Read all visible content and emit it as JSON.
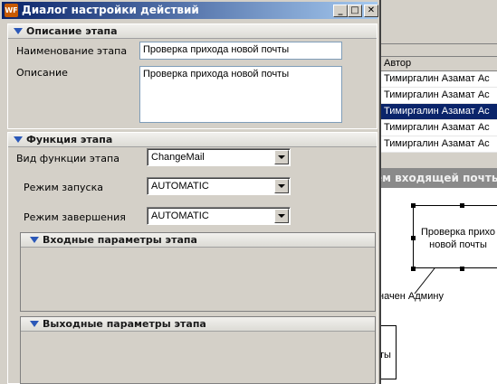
{
  "dialog": {
    "title": "Диалог настройки действий",
    "app_icon_text": "WF",
    "minimize_glyph": "_",
    "maximize_glyph": "□",
    "close_glyph": "✕"
  },
  "stage_description": {
    "header": "Описание этапа",
    "name_label": "Наименование этапа",
    "name_value": "Проверка прихода новой почты",
    "description_label": "Описание",
    "description_value": "Проверка прихода новой почты"
  },
  "stage_function": {
    "header": "Функция этапа",
    "function_type_label": "Вид функции этапа",
    "function_type_value": "ChangeMail",
    "start_mode_label": "Режим запуска",
    "start_mode_value": "AUTOMATIC",
    "finish_mode_label": "Режим завершения",
    "finish_mode_value": "AUTOMATIC",
    "input_params_header": "Входные параметры этапа",
    "output_params_header": "Выходные параметры этапа"
  },
  "background": {
    "author_column": "Автор",
    "rows": [
      "Тимиргалин Азамат Ас",
      "Тимиргалин Азамат Ас",
      "Тимиргалин Азамат Ас",
      "Тимиргалин Азамат Ас",
      "Тимиргалин Азамат Ас"
    ],
    "selected_row": 2,
    "panel_title": "ем входящей почты",
    "node_text_line1": "Проверка прихо",
    "node_text_line2": "новой почты",
    "edge_label": "начен Админу",
    "node2_text": "ты"
  }
}
